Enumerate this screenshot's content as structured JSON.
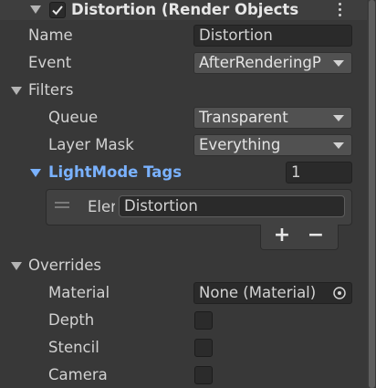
{
  "header": {
    "title": "Distortion (Render Objects",
    "enabled": true,
    "icons": {
      "foldout": "triangle-down-icon",
      "check": "checkmark-icon",
      "menu": "kebab-menu-icon"
    }
  },
  "name": {
    "label": "Name",
    "value": "Distortion"
  },
  "event": {
    "label": "Event",
    "value": "AfterRenderingP"
  },
  "filters": {
    "label": "Filters",
    "queue": {
      "label": "Queue",
      "value": "Transparent"
    },
    "layer_mask": {
      "label": "Layer Mask",
      "value": "Everything"
    },
    "lightmode_tags": {
      "label": "LightMode Tags",
      "count": "1",
      "element_label": "Eler",
      "element_value": "Distortion",
      "add_label": "+",
      "remove_label": "−"
    }
  },
  "overrides": {
    "label": "Overrides",
    "material": {
      "label": "Material",
      "value": "None (Material)"
    },
    "depth": {
      "label": "Depth",
      "checked": false
    },
    "stencil": {
      "label": "Stencil",
      "checked": false
    },
    "camera": {
      "label": "Camera",
      "checked": false
    }
  },
  "colors": {
    "background": "#383838",
    "accent_label": "#7ab2ff",
    "field": "#2a2a2a",
    "dropdown": "#515151",
    "header": "#3e3e3e"
  }
}
